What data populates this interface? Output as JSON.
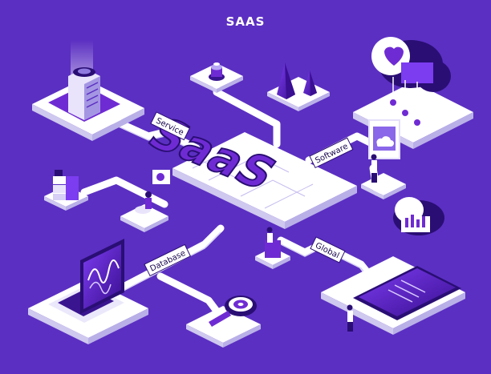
{
  "title": "SAAS",
  "center_logo": "SaaS",
  "labels": {
    "service": "Service",
    "software": "Software",
    "database": "Database",
    "global": "Global"
  },
  "colors": {
    "background": "#5b2fc2",
    "platform_top": "#ffffff",
    "platform_side": "#c9c2ee",
    "accent": "#6f2bd3",
    "accent_dark": "#2a0e74",
    "path": "#ffffff"
  },
  "icons": [
    "server-icon",
    "beacon-icon",
    "cone-icon",
    "heart-cloud-icon",
    "database-stack-icon",
    "person-icon",
    "laptop-icon",
    "magnifier-gear-icon",
    "tablet-icon",
    "cloud-data-icon"
  ]
}
